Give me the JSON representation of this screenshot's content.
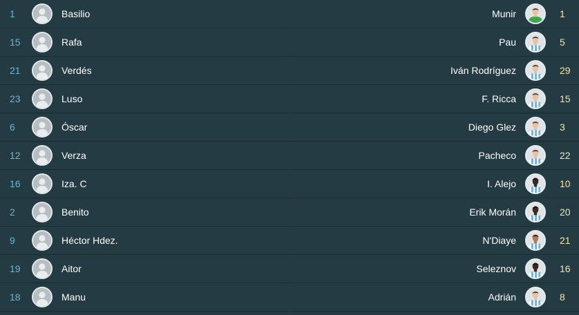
{
  "home": {
    "players": [
      {
        "number": "1",
        "name": "Basilio"
      },
      {
        "number": "15",
        "name": "Rafa"
      },
      {
        "number": "21",
        "name": "Verdés"
      },
      {
        "number": "23",
        "name": "Luso"
      },
      {
        "number": "6",
        "name": "Óscar"
      },
      {
        "number": "12",
        "name": "Verza"
      },
      {
        "number": "16",
        "name": "Iza. C"
      },
      {
        "number": "2",
        "name": "Benito"
      },
      {
        "number": "9",
        "name": "Héctor Hdez."
      },
      {
        "number": "19",
        "name": "Aitor"
      },
      {
        "number": "18",
        "name": "Manu"
      }
    ]
  },
  "away": {
    "players": [
      {
        "number": "1",
        "name": "Munir",
        "kit": "goalkeeper-green",
        "skin": "light"
      },
      {
        "number": "5",
        "name": "Pau",
        "kit": "sky-white-stripes",
        "skin": "light"
      },
      {
        "number": "29",
        "name": "Iván Rodríguez",
        "kit": "sky-white-stripes",
        "skin": "light"
      },
      {
        "number": "15",
        "name": "F. Ricca",
        "kit": "sky-white-stripes",
        "skin": "light"
      },
      {
        "number": "3",
        "name": "Diego Glez",
        "kit": "sky-white-stripes",
        "skin": "light"
      },
      {
        "number": "22",
        "name": "Pacheco",
        "kit": "sky-white-stripes",
        "skin": "light"
      },
      {
        "number": "10",
        "name": "I. Alejo",
        "kit": "sky-white-stripes",
        "skin": "dark"
      },
      {
        "number": "20",
        "name": "Erik Morán",
        "kit": "sky-white-stripes",
        "skin": "dark"
      },
      {
        "number": "21",
        "name": "N'Diaye",
        "kit": "sky-white-stripes",
        "skin": "medium"
      },
      {
        "number": "16",
        "name": "Seleznov",
        "kit": "sky-white-stripes",
        "skin": "dark"
      },
      {
        "number": "8",
        "name": "Adrián",
        "kit": "sky-white-stripes",
        "skin": "light"
      }
    ]
  },
  "colors": {
    "background": "#243b44",
    "divider": "#1a2b32",
    "home_number": "#69b7d6",
    "away_number": "#f3e6a7",
    "name": "#ffffff"
  },
  "icons": {
    "placeholder_avatar": "user-silhouette-icon",
    "player_photo": "player-photo-icon"
  }
}
